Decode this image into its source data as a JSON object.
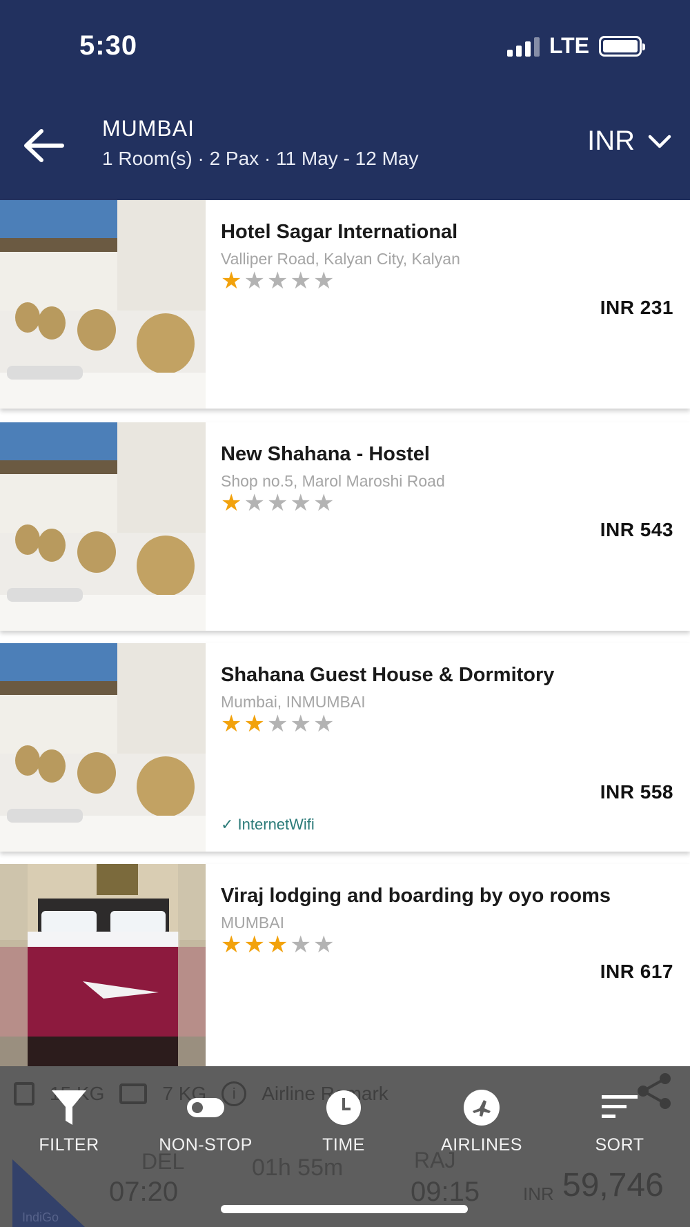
{
  "status_bar": {
    "time": "5:30",
    "network": "LTE"
  },
  "header": {
    "city": "MUMBAI",
    "search_summary": "1 Room(s) · 2 Pax · 11 May - 12 May",
    "currency": "INR"
  },
  "hotels": [
    {
      "name": "Hotel Sagar International",
      "address": "Valliper Road, Kalyan City, Kalyan",
      "rating": 1,
      "max_rating": 5,
      "price": "INR 231",
      "amenity": ""
    },
    {
      "name": "New Shahana - Hostel",
      "address": "Shop no.5, Marol Maroshi Road",
      "rating": 1,
      "max_rating": 5,
      "price": "INR 543",
      "amenity": ""
    },
    {
      "name": "Shahana Guest House & Dormitory",
      "address": "Mumbai, INMUMBAI",
      "rating": 2,
      "max_rating": 5,
      "price": "INR 558",
      "amenity": "✓ InternetWifi"
    },
    {
      "name": "Viraj lodging and boarding by oyo rooms",
      "address": "MUMBAI",
      "rating": 3,
      "max_rating": 5,
      "price": "INR 617",
      "amenity": ""
    }
  ],
  "bottom_toolbar": {
    "items": [
      {
        "label": "FILTER",
        "icon": "filter-icon"
      },
      {
        "label": "NON-STOP",
        "icon": "toggle-icon"
      },
      {
        "label": "TIME",
        "icon": "clock-icon"
      },
      {
        "label": "AIRLINES",
        "icon": "airplane-icon"
      },
      {
        "label": "SORT",
        "icon": "sort-icon"
      }
    ],
    "share_icon": "share-icon"
  },
  "background_flight": {
    "baggage_checkin": "15 KG",
    "baggage_cabin": "7 KG",
    "remark": "Airline Remark",
    "from_code": "DEL",
    "depart_time": "07:20",
    "duration": "01h 55m",
    "to_code": "RAJ",
    "arrive_time": "09:15",
    "price_currency": "INR",
    "price_value": "59,746",
    "airline_logo_text": "IndiGo"
  },
  "colors": {
    "header_bg": "#22315f",
    "star_on": "#f2a20c",
    "star_off": "#b3b3b3",
    "amenity": "#2b7a78",
    "toolbar_overlay": "#5e5e5e"
  }
}
